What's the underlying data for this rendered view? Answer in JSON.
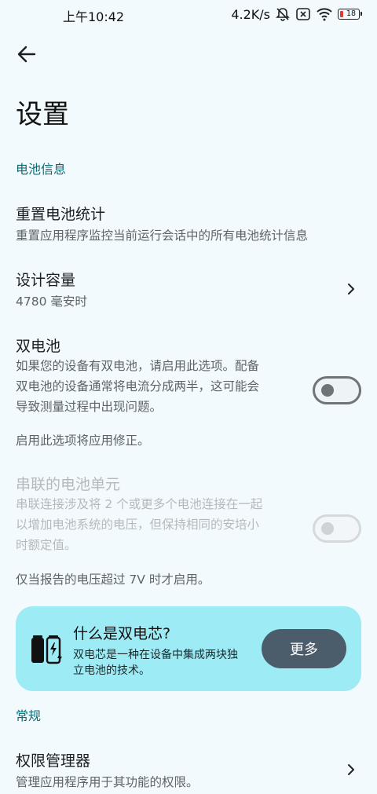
{
  "status_bar": {
    "time": "上午10:42",
    "network_speed": "4.2K/s",
    "battery_level": "18",
    "icons": [
      "mute-bell-icon",
      "sim-off-icon",
      "wifi-icon",
      "battery-icon"
    ]
  },
  "header": {
    "back_icon": "arrow-left-icon",
    "title": "设置"
  },
  "sections": {
    "battery_info": {
      "header": "电池信息",
      "reset_stats": {
        "title": "重置电池统计",
        "subtitle": "重置应用程序监控当前运行会话中的所有电池统计信息"
      },
      "design_capacity": {
        "title": "设计容量",
        "value": "4780 毫安时"
      },
      "dual_battery": {
        "title": "双电池",
        "desc_line1": "如果您的设备有双电池，请启用此选项。配备",
        "desc_line2": "双电池的设备通常将电流分成两半，这可能会",
        "desc_line3": "导致测量过程中出现问题。",
        "enabled": false,
        "note": "启用此选项将应用修正。"
      },
      "series_cells": {
        "title": "串联的电池单元",
        "desc_line1": "串联连接涉及将 2 个或更多个电池连接在一起",
        "desc_line2": "以增加电池系统的电压，但保持相同的安培小",
        "desc_line3": "时额定值。",
        "enabled": false,
        "note": "仅当报告的电压超过 7V 时才启用。"
      }
    },
    "info_card": {
      "title": "什么是双电芯?",
      "desc_line1": "双电芯是一种在设备中集成两块独",
      "desc_line2": "立电池的技术。",
      "button_label": "更多",
      "icon": "dual-battery-icon",
      "background": "#9debf4"
    },
    "general": {
      "header": "常规",
      "permission_manager": {
        "title": "权限管理器",
        "subtitle": "管理应用程序用于其功能的权限。"
      }
    }
  },
  "colors": {
    "background": "#f2fafd",
    "accent": "#0b6b73",
    "button": "#4b5d6b"
  }
}
